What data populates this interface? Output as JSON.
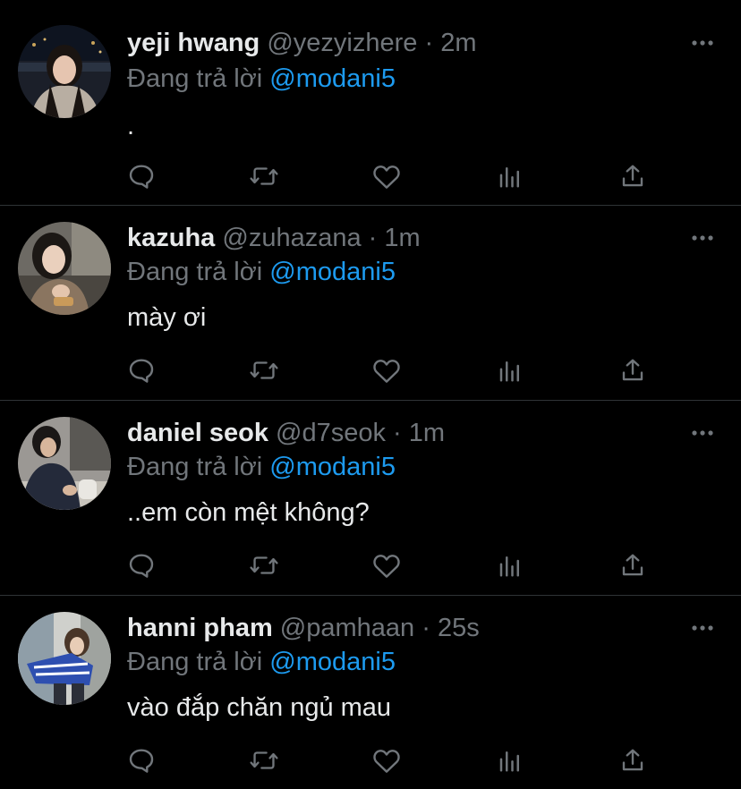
{
  "colors": {
    "background": "#000000",
    "name": "#e7e9ea",
    "secondary": "#71767b",
    "mention": "#1d9bf0",
    "divider": "#2f3336"
  },
  "replies": [
    {
      "name": "yeji hwang",
      "handle": "@yezyizhere",
      "separator": "·",
      "time": "2m",
      "replying_prefix": "Đang trả lời",
      "mention": "@modani5",
      "text": ".",
      "avatar": "avatar-photo"
    },
    {
      "name": "kazuha",
      "handle": "@zuhazana",
      "separator": "·",
      "time": "1m",
      "replying_prefix": "Đang trả lời",
      "mention": "@modani5",
      "text": "mày ơi",
      "avatar": "avatar-photo"
    },
    {
      "name": "daniel seok",
      "handle": "@d7seok",
      "separator": "·",
      "time": "1m",
      "replying_prefix": "Đang trả lời",
      "mention": "@modani5",
      "text": "..em còn mệt không?",
      "avatar": "avatar-photo"
    },
    {
      "name": "hanni pham",
      "handle": "@pamhaan",
      "separator": "·",
      "time": "25s",
      "replying_prefix": "Đang trả lời",
      "mention": "@modani5",
      "text": "vào đắp chăn ngủ mau",
      "avatar": "avatar-photo"
    }
  ],
  "action_icons": [
    "reply-icon",
    "retweet-icon",
    "like-icon",
    "analytics-icon",
    "share-icon"
  ]
}
